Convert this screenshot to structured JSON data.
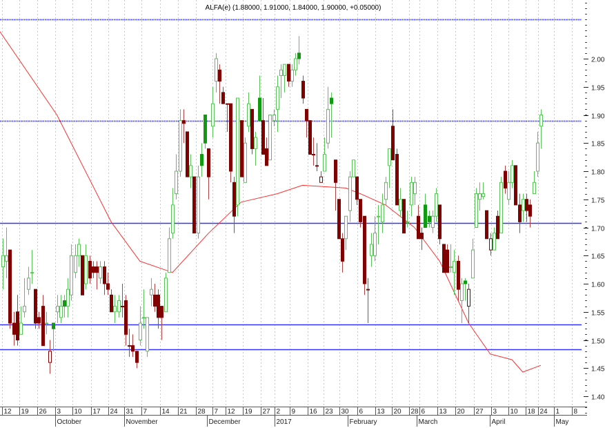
{
  "chart_data": {
    "type": "candlestick",
    "title": "ALFA(e) (1.88000, 1.91000, 1.84000, 1.90000, +0.05000)",
    "ylim": [
      1.37,
      2.1
    ],
    "yticks": [
      "1.40",
      "1.45",
      "1.50",
      "1.55",
      "1.60",
      "1.65",
      "1.70",
      "1.75",
      "1.80",
      "1.85",
      "1.90",
      "1.95",
      "2.00"
    ],
    "colors": {
      "up_body": "#58c158",
      "up_filled": "#109a10",
      "down": "#800000",
      "level": "#3333ff",
      "ma": "#ff3030"
    },
    "levels": [
      {
        "value": 2.07,
        "style": "dotted"
      },
      {
        "value": 1.89,
        "style": "dotted"
      },
      {
        "value": 1.708,
        "style": "solid"
      },
      {
        "value": 1.527,
        "style": "solid"
      },
      {
        "value": 1.483,
        "style": "solid"
      }
    ],
    "xticks": [
      {
        "label": "12",
        "i": -0.2
      },
      {
        "label": "19",
        "i": 4.6
      },
      {
        "label": "26",
        "i": 9.5
      },
      {
        "label": "3",
        "i": 14.5
      },
      {
        "label": "10",
        "i": 19.3
      },
      {
        "label": "17",
        "i": 24.4
      },
      {
        "label": "24",
        "i": 29.2
      },
      {
        "label": "31",
        "i": 33.6
      },
      {
        "label": "7",
        "i": 38.4
      },
      {
        "label": "14",
        "i": 43.5
      },
      {
        "label": "21",
        "i": 48.5
      },
      {
        "label": "28",
        "i": 53.5
      },
      {
        "label": "7",
        "i": 58.1
      },
      {
        "label": "12",
        "i": 61.7
      },
      {
        "label": "19",
        "i": 66.5
      },
      {
        "label": "27",
        "i": 71.4
      },
      {
        "label": "2",
        "i": 75.3
      },
      {
        "label": "9",
        "i": 79.5
      },
      {
        "label": "16",
        "i": 84.4
      },
      {
        "label": "23",
        "i": 88.8
      },
      {
        "label": "30",
        "i": 93.2
      },
      {
        "label": "6",
        "i": 98.2
      },
      {
        "label": "13",
        "i": 103.1
      },
      {
        "label": "20",
        "i": 107.7
      },
      {
        "label": "28",
        "i": 112.5
      },
      {
        "label": "6",
        "i": 115.4
      },
      {
        "label": "13",
        "i": 120.3
      },
      {
        "label": "20",
        "i": 125.3
      },
      {
        "label": "27",
        "i": 130.5
      },
      {
        "label": "3",
        "i": 135.2
      },
      {
        "label": "10",
        "i": 140
      },
      {
        "label": "18",
        "i": 144.8
      },
      {
        "label": "24",
        "i": 148.2
      },
      {
        "label": "1",
        "i": 152.6
      },
      {
        "label": "8",
        "i": 157.6
      }
    ],
    "months": [
      {
        "label": "October",
        "i": 14.5
      },
      {
        "label": "November",
        "i": 33.6
      },
      {
        "label": "December",
        "i": 56.5
      },
      {
        "label": "2017",
        "i": 75.3
      },
      {
        "label": "February",
        "i": 95.5
      },
      {
        "label": "March",
        "i": 114.6
      },
      {
        "label": "April",
        "i": 134.9
      },
      {
        "label": "May",
        "i": 152.6
      }
    ],
    "ohlc": [
      [
        1.63,
        1.68,
        1.59,
        1.65,
        "u"
      ],
      [
        1.64,
        1.7,
        1.61,
        1.65,
        "u"
      ],
      [
        1.66,
        1.66,
        1.52,
        1.53,
        "d"
      ],
      [
        1.53,
        1.55,
        1.49,
        1.51,
        "d"
      ],
      [
        1.55,
        1.58,
        1.49,
        1.5,
        "d"
      ],
      [
        1.51,
        1.56,
        1.51,
        1.53,
        "u"
      ],
      [
        1.55,
        1.61,
        1.54,
        1.56,
        "u"
      ],
      [
        1.59,
        1.63,
        1.58,
        1.61,
        "u"
      ],
      [
        1.62,
        1.66,
        1.6,
        1.62,
        "u"
      ],
      [
        1.59,
        1.59,
        1.52,
        1.53,
        "d"
      ],
      [
        1.54,
        1.55,
        1.52,
        1.53,
        "d"
      ],
      [
        1.56,
        1.58,
        1.49,
        1.49,
        "d"
      ],
      [
        1.53,
        1.55,
        1.51,
        1.53,
        "u"
      ],
      [
        1.46,
        1.5,
        1.44,
        1.48,
        "d"
      ],
      [
        1.53,
        1.53,
        1.48,
        1.52,
        "u"
      ],
      [
        1.55,
        1.58,
        1.53,
        1.56,
        "u"
      ],
      [
        1.54,
        1.58,
        1.53,
        1.56,
        "u"
      ],
      [
        1.57,
        1.58,
        1.54,
        1.56,
        "u"
      ],
      [
        1.56,
        1.61,
        1.54,
        1.59,
        "u"
      ],
      [
        1.58,
        1.67,
        1.57,
        1.65,
        "u"
      ],
      [
        1.62,
        1.67,
        1.61,
        1.65,
        "u"
      ],
      [
        1.65,
        1.68,
        1.63,
        1.67,
        "u"
      ],
      [
        1.65,
        1.65,
        1.58,
        1.58,
        "d"
      ],
      [
        1.6,
        1.67,
        1.59,
        1.65,
        "u"
      ],
      [
        1.64,
        1.65,
        1.6,
        1.61,
        "d"
      ],
      [
        1.63,
        1.64,
        1.61,
        1.62,
        "d"
      ],
      [
        1.63,
        1.64,
        1.59,
        1.62,
        "d"
      ],
      [
        1.61,
        1.64,
        1.6,
        1.63,
        "u"
      ],
      [
        1.63,
        1.64,
        1.58,
        1.6,
        "d"
      ],
      [
        1.6,
        1.62,
        1.58,
        1.59,
        "d"
      ],
      [
        1.58,
        1.59,
        1.55,
        1.55,
        "d"
      ],
      [
        1.55,
        1.58,
        1.53,
        1.56,
        "u"
      ],
      [
        1.55,
        1.58,
        1.54,
        1.57,
        "u"
      ],
      [
        1.56,
        1.6,
        1.54,
        1.56,
        "d"
      ],
      [
        1.57,
        1.58,
        1.49,
        1.51,
        "d"
      ],
      [
        1.49,
        1.52,
        1.47,
        1.49,
        "d"
      ],
      [
        1.49,
        1.51,
        1.47,
        1.48,
        "d"
      ],
      [
        1.48,
        1.48,
        1.45,
        1.46,
        "d"
      ],
      [
        1.5,
        1.56,
        1.49,
        1.53,
        "u"
      ],
      [
        1.54,
        1.59,
        1.52,
        1.54,
        "u"
      ],
      [
        1.48,
        1.54,
        1.47,
        1.54,
        "u"
      ],
      [
        1.58,
        1.61,
        1.56,
        1.59,
        "u"
      ],
      [
        1.58,
        1.6,
        1.55,
        1.56,
        "d"
      ],
      [
        1.58,
        1.59,
        1.52,
        1.54,
        "d"
      ],
      [
        1.56,
        1.56,
        1.5,
        1.54,
        "d"
      ],
      [
        1.55,
        1.62,
        1.55,
        1.61,
        "u"
      ],
      [
        1.62,
        1.7,
        1.62,
        1.68,
        "u"
      ],
      [
        1.69,
        1.77,
        1.68,
        1.74,
        "u"
      ],
      [
        1.76,
        1.83,
        1.75,
        1.8,
        "u"
      ],
      [
        1.8,
        1.91,
        1.79,
        1.89,
        "u"
      ],
      [
        1.89,
        1.91,
        1.85,
        1.885,
        "d"
      ],
      [
        1.87,
        1.87,
        1.79,
        1.79,
        "d"
      ],
      [
        1.79,
        1.83,
        1.77,
        1.81,
        "u"
      ],
      [
        1.79,
        1.79,
        1.69,
        1.69,
        "d"
      ],
      [
        1.69,
        1.81,
        1.68,
        1.79,
        "u"
      ],
      [
        1.83,
        1.85,
        1.79,
        1.81,
        "u"
      ],
      [
        1.9,
        1.9,
        1.84,
        1.85,
        "u"
      ],
      [
        1.84,
        1.84,
        1.75,
        1.79,
        "d"
      ],
      [
        1.88,
        1.95,
        1.86,
        1.92,
        "u"
      ],
      [
        1.96,
        2.01,
        1.94,
        2.0,
        "u"
      ],
      [
        1.98,
        1.99,
        1.92,
        1.96,
        "d"
      ],
      [
        1.94,
        1.95,
        1.92,
        1.92,
        "d"
      ],
      [
        1.92,
        1.92,
        1.87,
        1.92,
        "d"
      ],
      [
        1.92,
        1.92,
        1.78,
        1.8,
        "d"
      ],
      [
        1.78,
        1.79,
        1.69,
        1.72,
        "d"
      ],
      [
        1.74,
        1.93,
        1.72,
        1.93,
        "u"
      ],
      [
        1.89,
        1.89,
        1.79,
        1.79,
        "d"
      ],
      [
        1.78,
        1.86,
        1.78,
        1.85,
        "u"
      ],
      [
        1.88,
        1.94,
        1.87,
        1.92,
        "u"
      ],
      [
        1.91,
        1.91,
        1.83,
        1.84,
        "d"
      ],
      [
        1.84,
        1.87,
        1.81,
        1.86,
        "u"
      ],
      [
        1.93,
        1.97,
        1.89,
        1.89,
        "u"
      ],
      [
        1.89,
        1.93,
        1.83,
        1.83,
        "d"
      ],
      [
        1.84,
        1.86,
        1.81,
        1.81,
        "d"
      ],
      [
        1.82,
        1.9,
        1.82,
        1.9,
        "u"
      ],
      [
        1.89,
        1.91,
        1.88,
        1.9,
        "u"
      ],
      [
        1.91,
        1.97,
        1.87,
        1.95,
        "u"
      ],
      [
        1.97,
        1.99,
        1.93,
        1.98,
        "u"
      ],
      [
        1.97,
        1.99,
        1.94,
        1.99,
        "u"
      ],
      [
        1.99,
        1.99,
        1.95,
        1.96,
        "d"
      ],
      [
        1.96,
        1.99,
        1.95,
        1.98,
        "u"
      ],
      [
        1.98,
        2.01,
        1.97,
        2.0,
        "u"
      ],
      [
        2.01,
        2.04,
        1.99,
        2.0,
        "u"
      ],
      [
        1.96,
        1.97,
        1.92,
        1.93,
        "d"
      ],
      [
        1.91,
        1.91,
        1.86,
        1.89,
        "d"
      ],
      [
        1.89,
        1.89,
        1.83,
        1.83,
        "d"
      ],
      [
        1.83,
        1.86,
        1.81,
        1.83,
        "d"
      ],
      [
        1.81,
        1.85,
        1.8,
        1.81,
        "d"
      ],
      [
        1.78,
        1.8,
        1.78,
        1.79,
        "d"
      ],
      [
        1.8,
        1.86,
        1.8,
        1.83,
        "u"
      ],
      [
        1.85,
        1.95,
        1.84,
        1.91,
        "u"
      ],
      [
        1.93,
        1.94,
        1.86,
        1.92,
        "u"
      ],
      [
        1.82,
        1.82,
        1.73,
        1.78,
        "d"
      ],
      [
        1.75,
        1.75,
        1.68,
        1.68,
        "d"
      ],
      [
        1.68,
        1.69,
        1.62,
        1.64,
        "d"
      ],
      [
        1.68,
        1.72,
        1.66,
        1.72,
        "u"
      ],
      [
        1.73,
        1.8,
        1.71,
        1.79,
        "u"
      ],
      [
        1.79,
        1.82,
        1.79,
        1.82,
        "u"
      ],
      [
        1.79,
        1.79,
        1.74,
        1.75,
        "d"
      ],
      [
        1.75,
        1.75,
        1.7,
        1.71,
        "d"
      ],
      [
        1.72,
        1.72,
        1.58,
        1.6,
        "d"
      ],
      [
        1.59,
        1.61,
        1.53,
        1.59,
        "d"
      ],
      [
        1.65,
        1.69,
        1.63,
        1.67,
        "u"
      ],
      [
        1.65,
        1.72,
        1.64,
        1.69,
        "u"
      ],
      [
        1.72,
        1.74,
        1.67,
        1.72,
        "u"
      ],
      [
        1.71,
        1.76,
        1.69,
        1.74,
        "u"
      ],
      [
        1.75,
        1.79,
        1.74,
        1.78,
        "u"
      ],
      [
        1.81,
        1.84,
        1.77,
        1.84,
        "u"
      ],
      [
        1.88,
        1.91,
        1.82,
        1.82,
        "d"
      ],
      [
        1.83,
        1.84,
        1.74,
        1.74,
        "d"
      ],
      [
        1.73,
        1.77,
        1.72,
        1.75,
        "u"
      ],
      [
        1.75,
        1.75,
        1.69,
        1.69,
        "d"
      ],
      [
        1.71,
        1.73,
        1.7,
        1.71,
        "u"
      ],
      [
        1.74,
        1.79,
        1.72,
        1.78,
        "u"
      ],
      [
        1.76,
        1.79,
        1.74,
        1.78,
        "u"
      ],
      [
        1.72,
        1.74,
        1.68,
        1.68,
        "d"
      ],
      [
        1.69,
        1.7,
        1.66,
        1.68,
        "d"
      ],
      [
        1.74,
        1.76,
        1.7,
        1.7,
        "u"
      ],
      [
        1.72,
        1.73,
        1.7,
        1.71,
        "u"
      ],
      [
        1.7,
        1.73,
        1.69,
        1.72,
        "u"
      ],
      [
        1.72,
        1.77,
        1.71,
        1.76,
        "u"
      ],
      [
        1.74,
        1.74,
        1.67,
        1.68,
        "d"
      ],
      [
        1.67,
        1.67,
        1.62,
        1.62,
        "d"
      ],
      [
        1.66,
        1.67,
        1.62,
        1.62,
        "d"
      ],
      [
        1.63,
        1.67,
        1.62,
        1.63,
        "u"
      ],
      [
        1.62,
        1.66,
        1.58,
        1.64,
        "u"
      ],
      [
        1.64,
        1.65,
        1.57,
        1.59,
        "d"
      ],
      [
        1.57,
        1.61,
        1.53,
        1.6,
        "u"
      ],
      [
        1.605,
        1.61,
        1.57,
        1.6,
        "u"
      ],
      [
        1.56,
        1.6,
        1.53,
        1.59,
        "d"
      ],
      [
        1.61,
        1.68,
        1.61,
        1.66,
        "u"
      ],
      [
        1.7,
        1.77,
        1.7,
        1.76,
        "u"
      ],
      [
        1.75,
        1.78,
        1.73,
        1.76,
        "u"
      ],
      [
        1.755,
        1.78,
        1.75,
        1.76,
        "u"
      ],
      [
        1.73,
        1.73,
        1.68,
        1.68,
        "d"
      ],
      [
        1.66,
        1.69,
        1.65,
        1.68,
        "d"
      ],
      [
        1.66,
        1.7,
        1.66,
        1.69,
        "u"
      ],
      [
        1.72,
        1.73,
        1.68,
        1.68,
        "d"
      ],
      [
        1.69,
        1.79,
        1.69,
        1.78,
        "u"
      ],
      [
        1.8,
        1.81,
        1.76,
        1.77,
        "d"
      ],
      [
        1.75,
        1.8,
        1.74,
        1.78,
        "u"
      ],
      [
        1.78,
        1.82,
        1.77,
        1.81,
        "u"
      ],
      [
        1.81,
        1.81,
        1.74,
        1.74,
        "d"
      ],
      [
        1.74,
        1.76,
        1.69,
        1.71,
        "d"
      ],
      [
        1.73,
        1.76,
        1.71,
        1.75,
        "u"
      ],
      [
        1.75,
        1.76,
        1.71,
        1.73,
        "d"
      ],
      [
        1.74,
        1.75,
        1.7,
        1.72,
        "d"
      ],
      [
        1.76,
        1.8,
        1.76,
        1.78,
        "u"
      ],
      [
        1.8,
        1.87,
        1.79,
        1.85,
        "u"
      ],
      [
        1.88,
        1.91,
        1.84,
        1.9,
        "u"
      ]
    ],
    "moving_average": [
      [
        -1,
        2.05
      ],
      [
        15,
        1.9
      ],
      [
        30,
        1.71
      ],
      [
        38,
        1.64
      ],
      [
        47,
        1.62
      ],
      [
        57,
        1.69
      ],
      [
        66,
        1.745
      ],
      [
        76,
        1.76
      ],
      [
        83,
        1.775
      ],
      [
        95,
        1.77
      ],
      [
        99,
        1.76
      ],
      [
        106,
        1.74
      ],
      [
        114,
        1.7
      ],
      [
        121,
        1.64
      ],
      [
        129,
        1.53
      ],
      [
        135,
        1.475
      ],
      [
        141,
        1.465
      ],
      [
        144,
        1.443
      ],
      [
        149,
        1.455
      ]
    ]
  }
}
